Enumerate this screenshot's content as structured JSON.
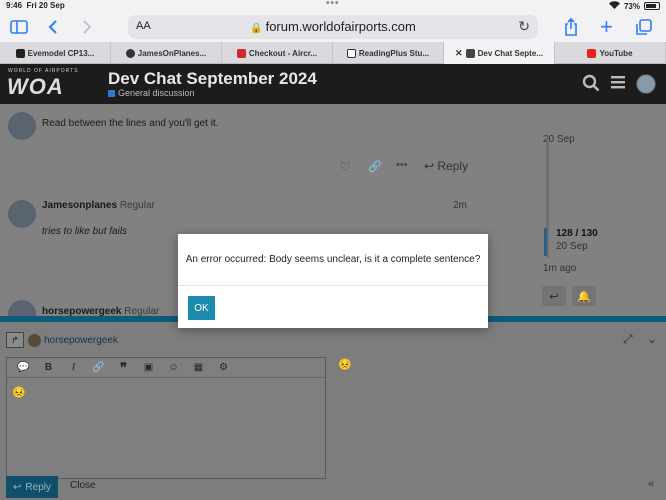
{
  "status": {
    "time": "9:46",
    "date": "Fri 20 Sep",
    "battery": "73%"
  },
  "browser": {
    "aa_label": "AA",
    "url": "forum.worldofairports.com",
    "tabs": [
      {
        "label": "Evemodel CP13...",
        "favicon": "amazon",
        "color": "#222222"
      },
      {
        "label": "JamesOnPlanes...",
        "favicon": "github",
        "color": "#333333"
      },
      {
        "label": "Checkout - Aircr...",
        "favicon": "aircraft",
        "color": "#d0282d"
      },
      {
        "label": "ReadingPlus Stu...",
        "favicon": "readingplus",
        "color": "#333333"
      },
      {
        "label": "Dev Chat Septe...",
        "favicon": "woa",
        "color": "#444444",
        "active": true
      },
      {
        "label": "YouTube",
        "favicon": "youtube",
        "color": "#e62117"
      }
    ]
  },
  "site": {
    "logo_small": "WORLD OF AIRPORTS",
    "logo_big": "WOA",
    "title": "Dev Chat September 2024",
    "category": "General discussion",
    "category_color": "#2a7bd3"
  },
  "posts": [
    {
      "text": "Read between the lines and you'll get it.",
      "reply_label": "Reply"
    },
    {
      "username": "Jamesonplanes",
      "role": "Regular",
      "age": "2m",
      "text": "tries to like but fails"
    },
    {
      "username": "horsepowergeek",
      "role": "Regular"
    }
  ],
  "timeline": {
    "top_date": "20 Sep",
    "position": "128 / 130",
    "position_date": "20 Sep",
    "last": "1m ago"
  },
  "composer": {
    "reply_to_user": "horsepowergeek",
    "editor_content": "😣",
    "preview_content": "😣",
    "reply_label": "Reply",
    "close_label": "Close"
  },
  "modal": {
    "message": "An error occurred: Body seems unclear, is it a complete sentence?",
    "ok_label": "OK"
  }
}
